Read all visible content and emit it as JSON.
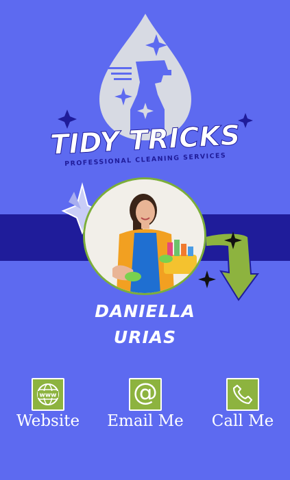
{
  "brand": {
    "name": "TIDY TRICKS",
    "tagline": "PROFESSIONAL CLEANING SERVICES"
  },
  "profile": {
    "first_name": "DANIELLA",
    "last_name": "URIAS"
  },
  "actions": [
    {
      "label": "Website",
      "icon": "globe-www-icon",
      "icon_text": "www"
    },
    {
      "label": "Email Me",
      "icon": "at-sign-icon",
      "icon_text": "@"
    },
    {
      "label": "Call Me",
      "icon": "phone-icon"
    }
  ],
  "colors": {
    "background": "#5d6af0",
    "band": "#1f1c9a",
    "accent_green": "#8db33f",
    "logo": "#d7dae3"
  }
}
